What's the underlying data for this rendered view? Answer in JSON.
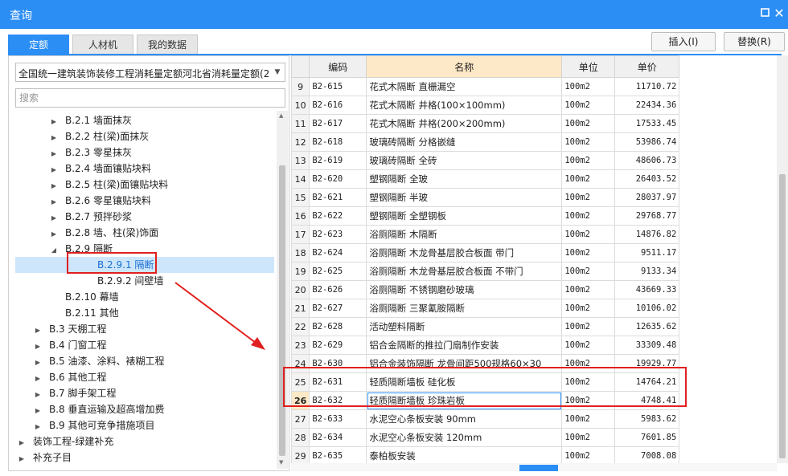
{
  "window": {
    "title": "查询"
  },
  "tabs": [
    {
      "label": "定额",
      "active": true
    },
    {
      "label": "人材机",
      "active": false
    },
    {
      "label": "我的数据",
      "active": false
    }
  ],
  "buttons": {
    "insert": "插入(I)",
    "replace": "替换(R)"
  },
  "left": {
    "dropdown_value": "全国统一建筑装饰装修工程消耗量定额河北省消耗量定额(20",
    "search_placeholder": "搜索",
    "tree": [
      {
        "label": "B.2.1 墙面抹灰",
        "level": 2,
        "toggle": "▶"
      },
      {
        "label": "B.2.2 柱(梁)面抹灰",
        "level": 2,
        "toggle": "▶"
      },
      {
        "label": "B.2.3 零星抹灰",
        "level": 2,
        "toggle": "▶"
      },
      {
        "label": "B.2.4 墙面镶贴块料",
        "level": 2,
        "toggle": "▶"
      },
      {
        "label": "B.2.5 柱(梁)面镶贴块料",
        "level": 2,
        "toggle": "▶"
      },
      {
        "label": "B.2.6 零星镶贴块料",
        "level": 2,
        "toggle": "▶"
      },
      {
        "label": "B.2.7 预拌砂浆",
        "level": 2,
        "toggle": "▶"
      },
      {
        "label": "B.2.8 墙、柱(梁)饰面",
        "level": 2,
        "toggle": "▶"
      },
      {
        "label": "B.2.9 隔断",
        "level": 2,
        "toggle": "◢"
      },
      {
        "label": "B.2.9.1 隔断",
        "level": 3,
        "toggle": "",
        "selected": true
      },
      {
        "label": "B.2.9.2 间壁墙",
        "level": 3,
        "toggle": ""
      },
      {
        "label": "B.2.10 幕墙",
        "level": 2,
        "toggle": ""
      },
      {
        "label": "B.2.11 其他",
        "level": 2,
        "toggle": ""
      },
      {
        "label": "B.3 天棚工程",
        "level": 1,
        "toggle": "▶"
      },
      {
        "label": "B.4 门窗工程",
        "level": 1,
        "toggle": "▶"
      },
      {
        "label": "B.5 油漆、涂料、裱糊工程",
        "level": 1,
        "toggle": "▶"
      },
      {
        "label": "B.6 其他工程",
        "level": 1,
        "toggle": "▶"
      },
      {
        "label": "B.7 脚手架工程",
        "level": 1,
        "toggle": "▶"
      },
      {
        "label": "B.8 垂直运输及超高增加费",
        "level": 1,
        "toggle": "▶"
      },
      {
        "label": "B.9 其他可竞争措施项目",
        "level": 1,
        "toggle": "▶"
      },
      {
        "label": "装饰工程-绿建补充",
        "level": 0,
        "toggle": "▶"
      },
      {
        "label": "补充子目",
        "level": 0,
        "toggle": "▶"
      }
    ]
  },
  "table": {
    "headers": [
      "编码",
      "名称",
      "单位",
      "单价"
    ],
    "rows": [
      {
        "n": "9",
        "code": "B2-615",
        "name": "花式木隔断 直栅漏空",
        "unit": "100m2",
        "price": "11710.72"
      },
      {
        "n": "10",
        "code": "B2-616",
        "name": "花式木隔断 井格(100×100mm)",
        "unit": "100m2",
        "price": "22434.36"
      },
      {
        "n": "11",
        "code": "B2-617",
        "name": "花式木隔断 井格(200×200mm)",
        "unit": "100m2",
        "price": "17533.45"
      },
      {
        "n": "12",
        "code": "B2-618",
        "name": "玻璃砖隔断 分格嵌缝",
        "unit": "100m2",
        "price": "53986.74"
      },
      {
        "n": "13",
        "code": "B2-619",
        "name": "玻璃砖隔断 全砖",
        "unit": "100m2",
        "price": "48606.73"
      },
      {
        "n": "14",
        "code": "B2-620",
        "name": "塑钢隔断 全玻",
        "unit": "100m2",
        "price": "26403.52"
      },
      {
        "n": "15",
        "code": "B2-621",
        "name": "塑钢隔断 半玻",
        "unit": "100m2",
        "price": "28037.97"
      },
      {
        "n": "16",
        "code": "B2-622",
        "name": "塑钢隔断 全塑钢板",
        "unit": "100m2",
        "price": "29768.77"
      },
      {
        "n": "17",
        "code": "B2-623",
        "name": "浴厕隔断 木隔断",
        "unit": "100m2",
        "price": "14876.82"
      },
      {
        "n": "18",
        "code": "B2-624",
        "name": "浴厕隔断 木龙骨基层胶合板面 带门",
        "unit": "100m2",
        "price": "9511.17"
      },
      {
        "n": "19",
        "code": "B2-625",
        "name": "浴厕隔断 木龙骨基层胶合板面 不带门",
        "unit": "100m2",
        "price": "9133.34"
      },
      {
        "n": "20",
        "code": "B2-626",
        "name": "浴厕隔断 不锈钢磨砂玻璃",
        "unit": "100m2",
        "price": "43669.33"
      },
      {
        "n": "21",
        "code": "B2-627",
        "name": "浴厕隔断 三聚氰胺隔断",
        "unit": "100m2",
        "price": "10106.02"
      },
      {
        "n": "22",
        "code": "B2-628",
        "name": "活动塑料隔断",
        "unit": "100m2",
        "price": "12635.62"
      },
      {
        "n": "23",
        "code": "B2-629",
        "name": "铝合金隔断的推拉门扇制作安装",
        "unit": "100m2",
        "price": "33309.48"
      },
      {
        "n": "24",
        "code": "B2-630",
        "name": "铝合金装饰隔断 龙骨间距500规格60×30",
        "unit": "100m2",
        "price": "19929.77"
      },
      {
        "n": "25",
        "code": "B2-631",
        "name": "轻质隔断墙板 硅化板",
        "unit": "100m2",
        "price": "14764.21"
      },
      {
        "n": "26",
        "code": "B2-632",
        "name": "轻质隔断墙板 珍珠岩板",
        "unit": "100m2",
        "price": "4748.41",
        "current": true
      },
      {
        "n": "27",
        "code": "B2-633",
        "name": "水泥空心条板安装 90mm",
        "unit": "100m2",
        "price": "5983.62"
      },
      {
        "n": "28",
        "code": "B2-634",
        "name": "水泥空心条板安装 120mm",
        "unit": "100m2",
        "price": "7601.85"
      },
      {
        "n": "29",
        "code": "B2-635",
        "name": "泰柏板安装",
        "unit": "100m2",
        "price": "7008.08"
      }
    ]
  },
  "colors": {
    "accent": "#2b8ef5",
    "highlight": "#e02020",
    "selected_bg": "#cde6fb",
    "name_header": "#fde9c7"
  }
}
